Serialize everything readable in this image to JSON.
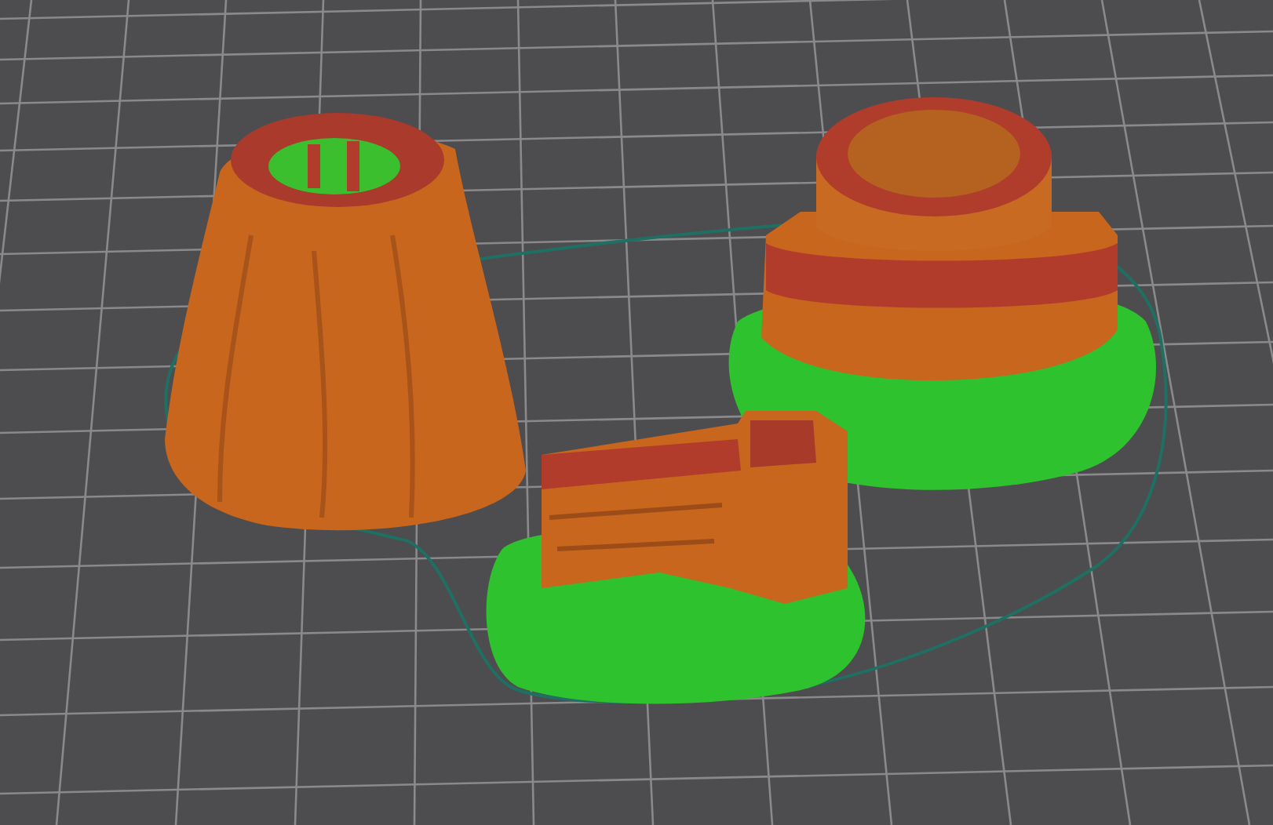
{
  "viewport": {
    "show_grid": true,
    "show_skirt": true,
    "show_support": true
  }
}
